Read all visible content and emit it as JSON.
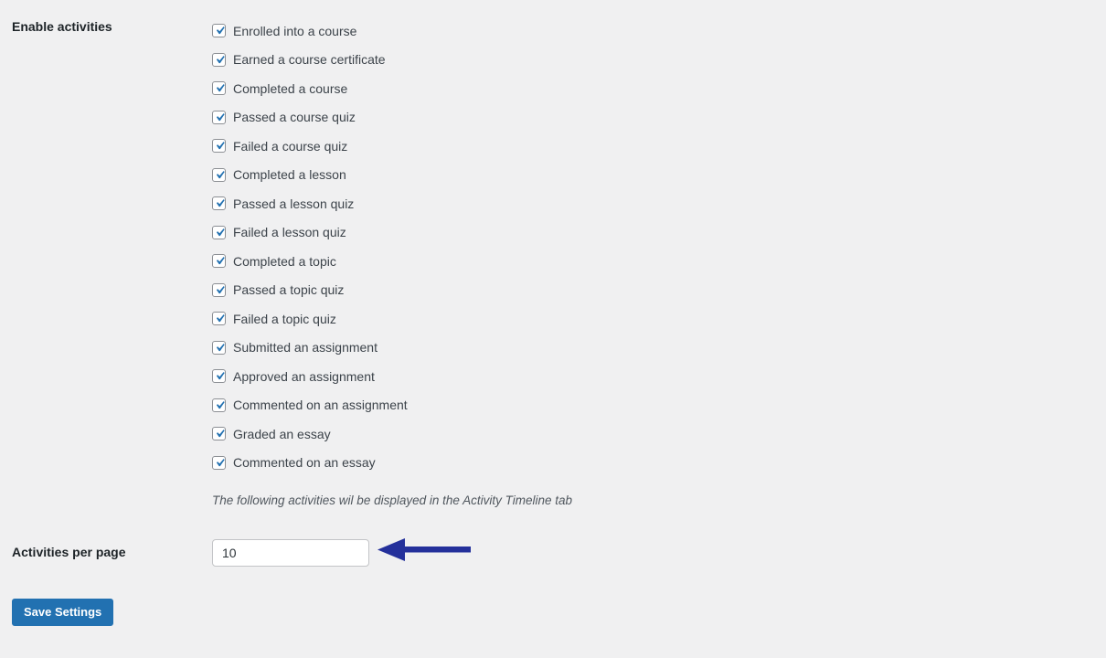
{
  "page": {
    "background_color": "#f0f0f1",
    "text_color": "#3c434a",
    "label_color": "#1d2327"
  },
  "enable_activities": {
    "label": "Enable activities",
    "hint": "The following activities wil be displayed in the Activity Timeline tab",
    "checkbox_check_color": "#2271b1",
    "items": [
      {
        "label": "Enrolled into a course",
        "checked": true
      },
      {
        "label": "Earned a course certificate",
        "checked": true
      },
      {
        "label": "Completed a course",
        "checked": true
      },
      {
        "label": "Passed a course quiz",
        "checked": true
      },
      {
        "label": "Failed a course quiz",
        "checked": true
      },
      {
        "label": "Completed a lesson",
        "checked": true
      },
      {
        "label": "Passed a lesson quiz",
        "checked": true
      },
      {
        "label": "Failed a lesson quiz",
        "checked": true
      },
      {
        "label": "Completed a topic",
        "checked": true
      },
      {
        "label": "Passed a topic quiz",
        "checked": true
      },
      {
        "label": "Failed a topic quiz",
        "checked": true
      },
      {
        "label": "Submitted an assignment",
        "checked": true
      },
      {
        "label": "Approved an assignment",
        "checked": true
      },
      {
        "label": "Commented on an assignment",
        "checked": true
      },
      {
        "label": "Graded an essay",
        "checked": true
      },
      {
        "label": "Commented on an essay",
        "checked": true
      }
    ]
  },
  "activities_per_page": {
    "label": "Activities per page",
    "value": "10",
    "placeholder": ""
  },
  "annotation": {
    "arrow_color": "#24309b",
    "direction": "left",
    "points_at": "activities-per-page-input"
  },
  "actions": {
    "save_label": "Save Settings",
    "save_color": "#2271b1"
  }
}
